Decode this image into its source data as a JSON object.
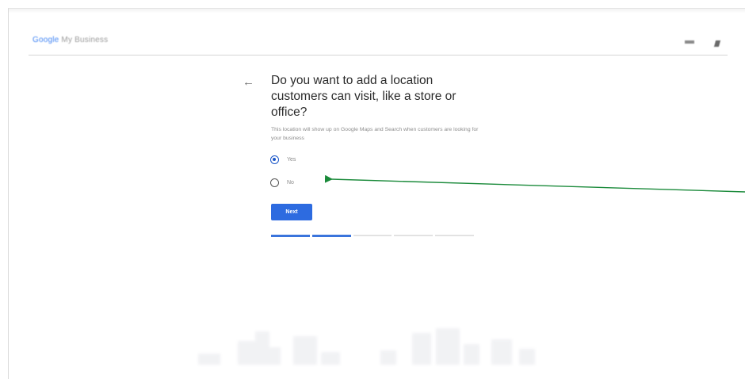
{
  "header": {
    "logo_prefix": "Google",
    "logo_suffix": " My Business"
  },
  "question": {
    "back_icon": "←",
    "title": "Do you want to add a location customers can visit, like a store or office?",
    "subtitle": "This location will show up on Google Maps and Search when customers are looking for your business"
  },
  "options": [
    {
      "label": "Yes",
      "selected": true
    },
    {
      "label": "No",
      "selected": false
    }
  ],
  "next_label": "Next",
  "progress": {
    "total_steps": 5,
    "completed_steps": 2
  },
  "colors": {
    "accent": "#2d6be0",
    "annotation_arrow": "#1a8a3a"
  },
  "icons": {
    "back": "back-arrow-icon",
    "apps": "apps-icon",
    "account": "account-icon"
  }
}
